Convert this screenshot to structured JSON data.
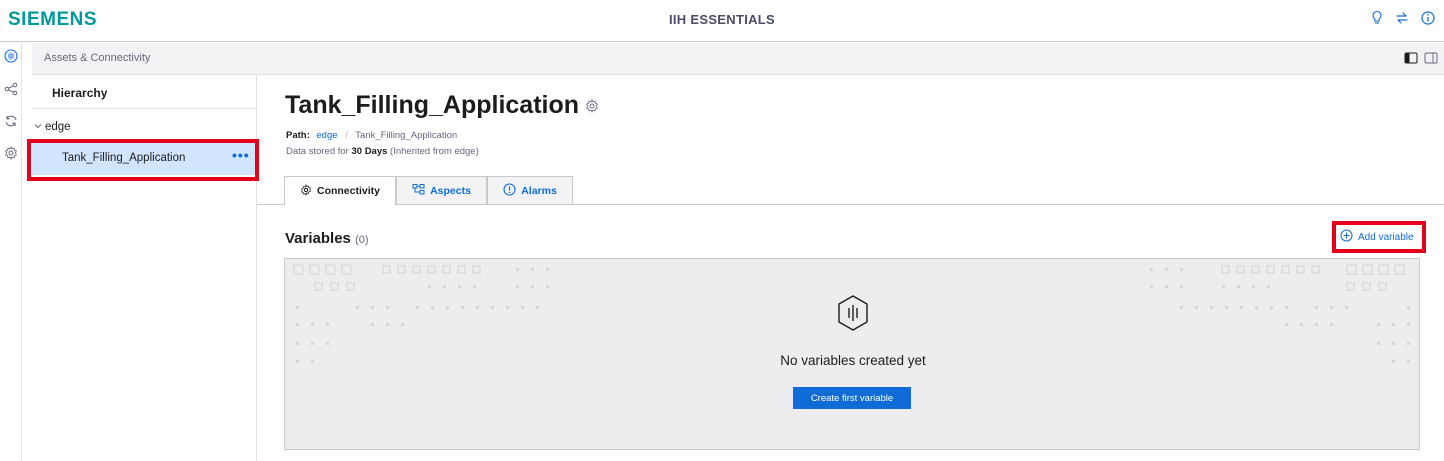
{
  "header": {
    "brand": "SIEMENS",
    "app_title": "IIH ESSENTIALS",
    "icons": [
      "lightbulb-icon",
      "switch-icon",
      "info-icon"
    ]
  },
  "rail": {
    "items": [
      "assets-icon",
      "share-icon",
      "sync-icon",
      "settings-icon"
    ]
  },
  "breadcrumb": {
    "label": "Assets & Connectivity"
  },
  "hierarchy": {
    "title": "Hierarchy",
    "root": "edge",
    "selected": "Tank_Filling_Application",
    "more": "•••"
  },
  "asset": {
    "title": "Tank_Filling_Application",
    "path_label": "Path:",
    "path_root": "edge",
    "path_sep": "/",
    "path_leaf": "Tank_Filling_Application",
    "retention_prefix": "Data stored for",
    "retention_value": "30 Days",
    "retention_suffix": "(Inherited from edge)"
  },
  "tabs": [
    {
      "label": "Connectivity",
      "icon": "connectivity-icon",
      "active": true
    },
    {
      "label": "Aspects",
      "icon": "aspects-icon",
      "active": false
    },
    {
      "label": "Alarms",
      "icon": "alarm-icon",
      "active": false
    }
  ],
  "variables": {
    "title": "Variables",
    "count": "(0)",
    "add_label": "Add variable",
    "empty_message": "No variables created yet",
    "create_label": "Create first variable"
  },
  "colors": {
    "brand": "#009999",
    "accent": "#0f6cd6",
    "selected_row": "#d1e5ff",
    "highlight": "#e4001c"
  }
}
